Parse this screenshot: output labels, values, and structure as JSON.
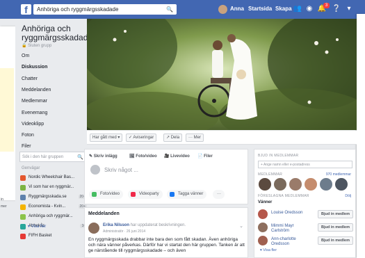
{
  "topbar": {
    "logo": "f",
    "search_text": "Anhöriga och ryggmärgsskadade",
    "user_name": "Anna",
    "home_label": "Startsida",
    "create_label": "Skapa",
    "notif_count": "3"
  },
  "sidebar": {
    "group_name": "Anhöriga och ryggmärgsskadade",
    "group_type": "Sluten grupp",
    "menu": [
      "Om",
      "Diskussion",
      "Chatter",
      "Meddelanden",
      "Medlemmar",
      "Evenemang",
      "Videoklipp",
      "Foton",
      "Filer"
    ],
    "search_placeholder": "Sök i den här gruppen",
    "groups_title": "Genvägar",
    "groups": [
      {
        "label": "Nordic Wheelchair Bas...",
        "count": "",
        "color": "#e4572e"
      },
      {
        "label": "Vi som har en ryggmär...",
        "count": "",
        "color": "#7cb342"
      },
      {
        "label": "Ryggmärgsskada.se",
        "count": "20+",
        "color": "#5e81ac"
      },
      {
        "label": "Economista - Kvin...",
        "count": "20+",
        "color": "#f4b400"
      },
      {
        "label": "Anhöriga och ryggmär...",
        "count": "",
        "color": "#8bc34a"
      },
      {
        "label": "Abbekås",
        "count": "16",
        "color": "#26a69a"
      },
      {
        "label": "FIFH Basket",
        "count": "",
        "color": "#e53935"
      }
    ],
    "see_more": "Visa fler"
  },
  "cover_toolbar": {
    "joined": "Har gått med ▾",
    "notifications": "✓ Aviseringar",
    "share": "↗ Dela",
    "more": "··· Mer"
  },
  "composer": {
    "tabs": [
      "Skriv inlägg",
      "Foto/video",
      "Livevideo",
      "Filer"
    ],
    "placeholder": "Skriv något ...",
    "buttons": [
      "Foto/video",
      "Videoparty",
      "Tagga vänner",
      "···"
    ]
  },
  "feed": {
    "heading": "Meddelanden",
    "author": "Erika Nilsson",
    "author_action": "har uppdaterat beskrivningen.",
    "meta": "Administratör · 26 juni 2014",
    "text": "En ryggmärgsskada drabbar inte bara den som fått skadan. Även anhöriga och nära vänner påverkas. Därför har vi startat den här gruppen. Tanken är att ge närstående till ryggmärgsskadade – och även"
  },
  "right": {
    "add_members_title": "BJUD IN MEDLEMMAR",
    "add_placeholder": "+ Ange namn eller e-postadress",
    "members_title": "MEDLEMMAR",
    "members_count": "970 medlemmar",
    "suggested_title": "FÖRESLAGNA MEDLEMMAR",
    "suggested_action": "Dölj",
    "friends_title": "Vänner",
    "friends": [
      {
        "name": "Louise Oredsson",
        "button": "Bjud in medlem"
      },
      {
        "name": "Mimmi Mayr Carlström",
        "button": "Bjud in medlem"
      },
      {
        "name": "Ann-charlotte Oredsson",
        "button": "Bjud in medlem"
      }
    ],
    "see_more": "Visa fler"
  },
  "ghost": {
    "label_in": "in",
    "label_mer": "mer"
  }
}
